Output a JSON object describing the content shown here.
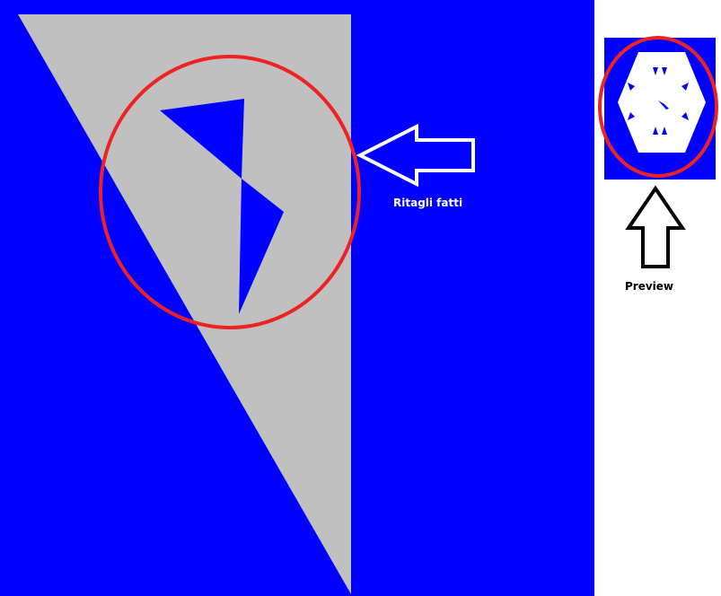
{
  "colors": {
    "canvas_bg": "#0000ff",
    "paper": "#c0c0c0",
    "highlight": "#ee2222",
    "preview_bg": "#0000ff",
    "preview_shape": "#ffffff",
    "page_bg": "#ffffff",
    "label_on_blue": "#ffffff",
    "label_on_white": "#000000"
  },
  "icons": {
    "left_arrow": "arrow-left-outline-icon",
    "up_arrow": "arrow-up-outline-icon"
  },
  "labels": {
    "cuts_done": "Ritagli fatti",
    "preview": "Preview"
  }
}
